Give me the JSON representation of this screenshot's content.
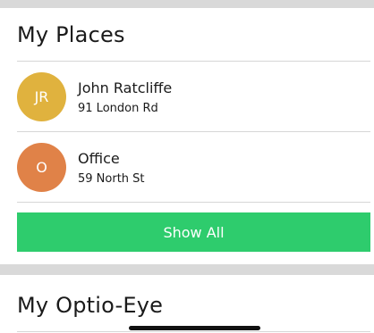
{
  "places_section": {
    "title": "My Places",
    "places": [
      {
        "initials": "JR",
        "name": "John Ratcliffe",
        "address": "91 London Rd",
        "color": "#e0b23e"
      },
      {
        "initials": "O",
        "name": "Office",
        "address": "59 North St",
        "color": "#e08248"
      }
    ],
    "show_all_label": "Show All",
    "show_all_color": "#2ecc6d"
  },
  "eye_section": {
    "title": "My Optio-Eye"
  }
}
